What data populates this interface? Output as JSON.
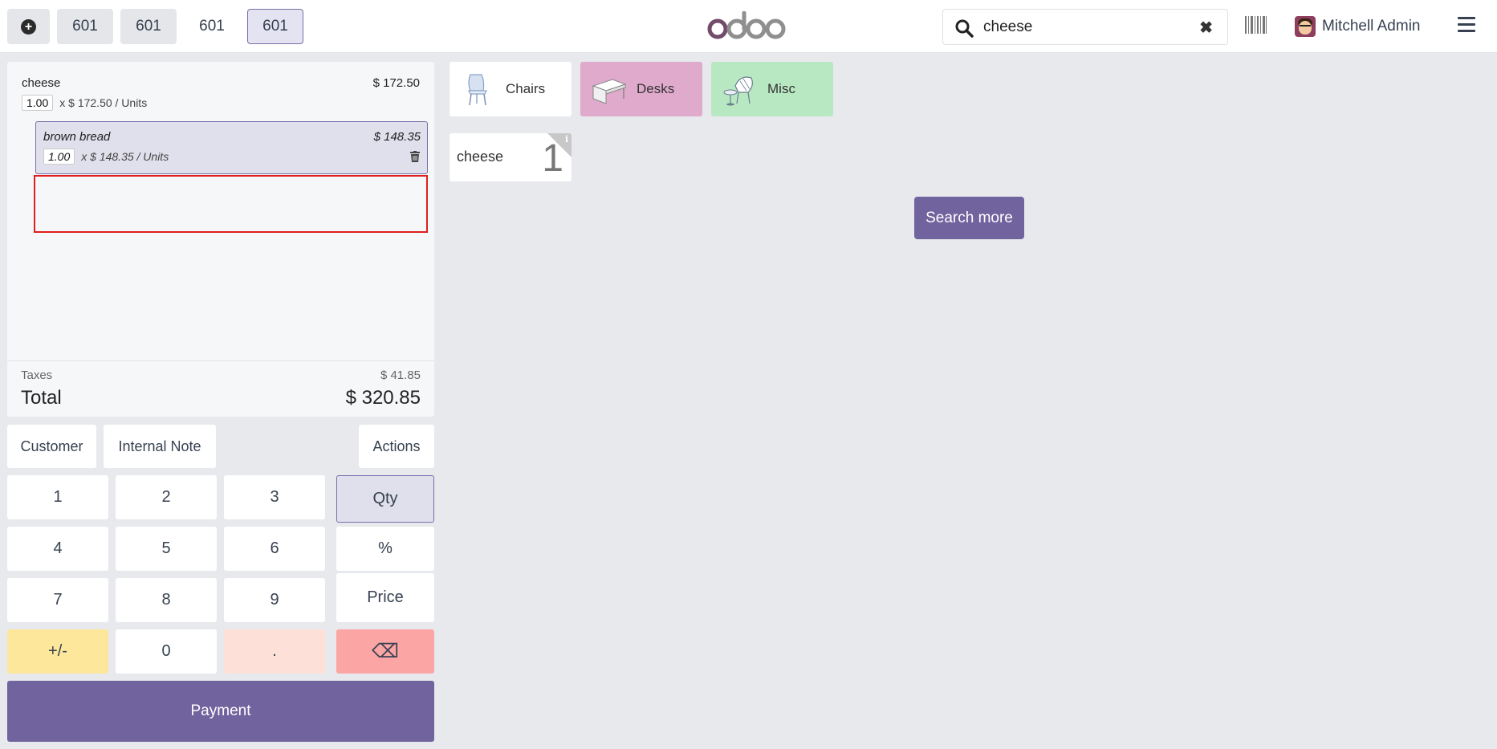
{
  "topbar": {
    "tabs": [
      "601",
      "601",
      "601",
      "601"
    ],
    "search": {
      "value": "cheese",
      "placeholder": "Search products..."
    },
    "user_name": "Mitchell Admin"
  },
  "order": {
    "lines": [
      {
        "name": "cheese",
        "price": "$ 172.50",
        "qty": "1.00",
        "unit_text": "x $ 172.50 / Units"
      },
      {
        "name": "brown bread",
        "price": "$ 148.35",
        "qty": "1.00",
        "unit_text": "x $ 148.35 / Units"
      }
    ],
    "taxes_label": "Taxes",
    "taxes_value": "$ 41.85",
    "total_label": "Total",
    "total_value": "$ 320.85"
  },
  "controls": {
    "customer": "Customer",
    "internal_note": "Internal Note",
    "actions": "Actions"
  },
  "numpad": {
    "k1": "1",
    "k2": "2",
    "k3": "3",
    "qty": "Qty",
    "k4": "4",
    "k5": "5",
    "k6": "6",
    "percent": "%",
    "k7": "7",
    "k8": "8",
    "k9": "9",
    "price": "Price",
    "plusminus": "+/-",
    "k0": "0",
    "dot": ".",
    "backspace": "⌫"
  },
  "payment_label": "Payment",
  "categories": [
    "Chairs",
    "Desks",
    "Misc"
  ],
  "category_colors": {
    "chairs": "#ffffff",
    "desks": "#dfaacb",
    "misc": "#b8e8c2"
  },
  "products": [
    {
      "name": "cheese",
      "qty": "1"
    }
  ],
  "search_more_label": "Search more",
  "colors": {
    "accent": "#71639e",
    "highlight_box": "#e01e1e"
  }
}
